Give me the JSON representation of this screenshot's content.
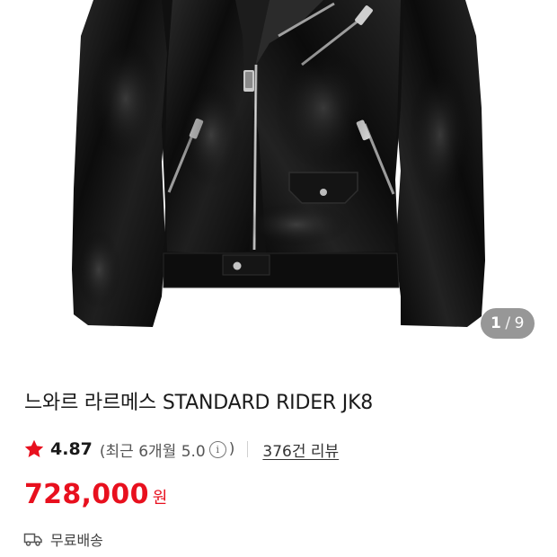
{
  "gallery": {
    "current_page": "1",
    "separator": "/",
    "total_pages": "9",
    "image_subject": "black leather rider jacket"
  },
  "product": {
    "title": "느와르 라르메스 STANDARD RIDER JK8",
    "rating": "4.87",
    "recent_rating": "(최근 6개월 5.0",
    "recent_close": ")",
    "review_count": "376건 리뷰",
    "price": "728,000",
    "currency": "원",
    "shipping": "무료배송"
  },
  "icons": {
    "rating": "star-icon",
    "info": "info-icon",
    "shipping": "truck-icon"
  },
  "colors": {
    "price": "#e8101e",
    "star": "#e8101e",
    "indicator_bg": "#808080"
  }
}
